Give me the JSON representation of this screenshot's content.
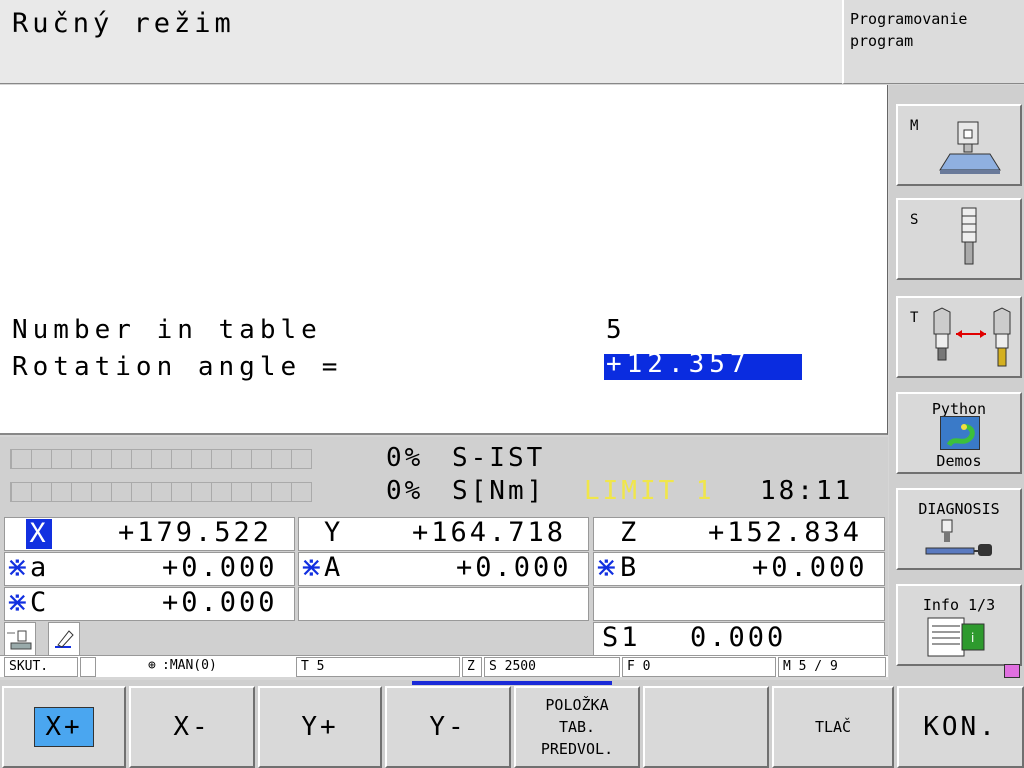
{
  "header": {
    "title": "Ručný režim",
    "mode_line1": "Programovanie",
    "mode_line2": "program"
  },
  "dialog": {
    "number_label": "Number in table",
    "number_value": "5",
    "rotation_label": "Rotation angle =",
    "rotation_value": "+12.357"
  },
  "status": {
    "line1_pct": "0%",
    "line1_label": "S-IST",
    "line2_pct": "0%",
    "line2_label": "S[Nm]",
    "limit": "LIMIT 1",
    "time": "18:11"
  },
  "positions": {
    "x": {
      "axis": "X",
      "value": "+179.522"
    },
    "y": {
      "axis": "Y",
      "value": "+164.718"
    },
    "z": {
      "axis": "Z",
      "value": "+152.834"
    },
    "a_small": {
      "axis": "a",
      "value": "+0.000"
    },
    "a": {
      "axis": "A",
      "value": "+0.000"
    },
    "b": {
      "axis": "B",
      "value": "+0.000"
    },
    "c": {
      "axis": "C",
      "value": "+0.000"
    },
    "spindle": "S1",
    "spindle_value": "0.000"
  },
  "info": {
    "skut": "SKUT.",
    "man": ":MAN(0)",
    "tool": "T 5",
    "z": "Z",
    "speed": "S 2500",
    "feed": "F 0",
    "m": "M 5 / 9"
  },
  "softkeys": {
    "xplus": "X+",
    "xminus": "X-",
    "yplus": "Y+",
    "yminus": "Y-",
    "preset": "POLOŽKA\nTAB.\nPREDVOL.",
    "print": "TLAČ",
    "end": "KON."
  },
  "side": {
    "m": "M",
    "s": "S",
    "t": "T",
    "python_top": "Python",
    "python_bottom": "Demos",
    "diagnosis": "DIAGNOSIS",
    "info": "Info 1/3"
  },
  "colors": {
    "highlight": "#0a2ce0",
    "limit": "#f0e64a",
    "python_icon": "#2e8b2e"
  }
}
